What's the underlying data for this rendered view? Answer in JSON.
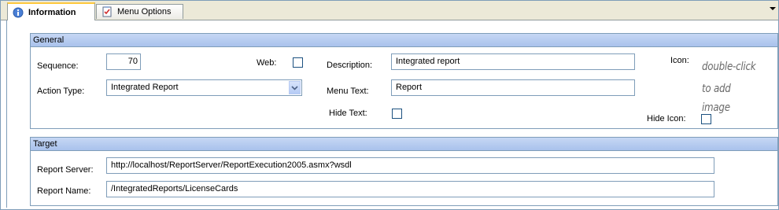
{
  "tabs": [
    {
      "label": "Information",
      "icon": "info-icon",
      "active": true
    },
    {
      "label": "Menu Options",
      "icon": "checklist-icon",
      "active": false
    }
  ],
  "general": {
    "title": "General",
    "sequence_label": "Sequence:",
    "sequence_value": "70",
    "web_label": "Web:",
    "web_checked": false,
    "description_label": "Description:",
    "description_value": "Integrated report",
    "icon_label": "Icon:",
    "icon_hint_line1": "double-click",
    "icon_hint_line2": "to add image",
    "action_type_label": "Action Type:",
    "action_type_value": "Integrated Report",
    "menu_text_label": "Menu Text:",
    "menu_text_value": "Report",
    "hide_text_label": "Hide Text:",
    "hide_text_checked": false,
    "hide_icon_label": "Hide Icon:",
    "hide_icon_checked": false
  },
  "target": {
    "title": "Target",
    "report_server_label": "Report Server:",
    "report_server_value": "http://localhost/ReportServer/ReportExecution2005.asmx?wsdl",
    "report_name_label": "Report Name:",
    "report_name_value": "/IntegratedReports/LicenseCards"
  }
}
